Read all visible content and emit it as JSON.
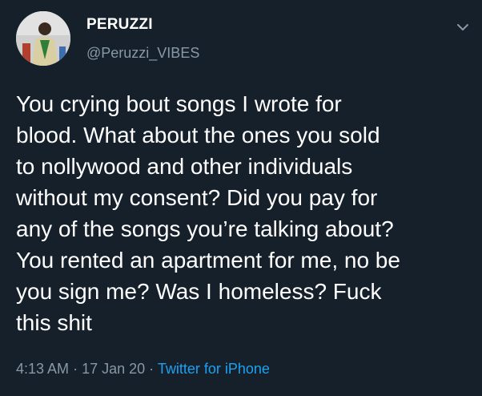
{
  "tweet": {
    "display_name": "PERUZZI",
    "handle": "@Peruzzi_VIBES",
    "text": "You crying bout songs I wrote for\nblood. What about the ones you sold\nto nollywood and other individuals\nwithout my consent? Did you pay for\nany of the songs you’re talking about?\nYou rented an apartment for me, no be\nyou sign me? Was I homeless? Fuck\nthis shit",
    "time": "4:13 AM",
    "separator": "·",
    "date": "17 Jan 20",
    "source": "Twitter for iPhone"
  },
  "icons": {
    "menu": "chevron-down-icon",
    "avatar": "user-avatar"
  },
  "colors": {
    "background": "#15202b",
    "text": "#ffffff",
    "secondary": "#8899a6",
    "link": "#1da1f2"
  }
}
